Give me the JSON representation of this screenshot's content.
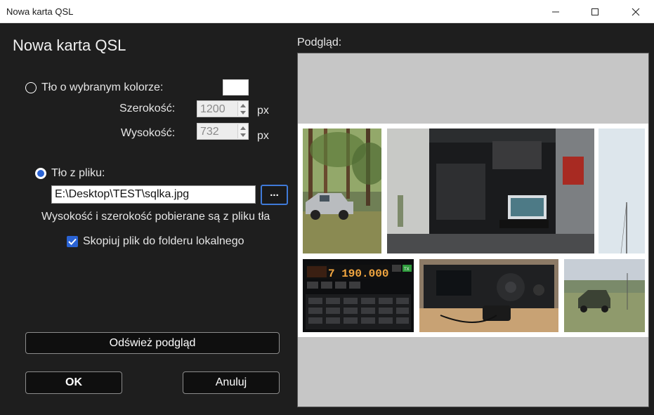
{
  "window": {
    "title": "Nowa karta QSL"
  },
  "dialog": {
    "heading": "Nowa karta QSL",
    "color_option_label": "Tło o wybranym kolorze:",
    "selected_color": "#ffffff",
    "width_label": "Szerokość:",
    "width_value": "1200",
    "height_label": "Wysokość:",
    "height_value": "732",
    "unit": "px",
    "file_option_label": "Tło z pliku:",
    "file_path": "E:\\Desktop\\TEST\\sqlka.jpg",
    "browse_label": "...",
    "file_info": "Wysokość i szerokość pobierane są z pliku tła",
    "copy_checkbox_label": "Skopiuj plik do folderu lokalnego",
    "copy_checked": true,
    "refresh_label": "Odśwież podgląd",
    "ok_label": "OK",
    "cancel_label": "Anuluj"
  },
  "preview": {
    "label": "Podgląd:",
    "radio_display": {
      "frequency": "7 190.000",
      "tx": "TX"
    }
  },
  "colors": {
    "accent": "#2a63d4",
    "dialog_bg": "#1e1e1e",
    "preview_bg": "#c6c6c6"
  }
}
